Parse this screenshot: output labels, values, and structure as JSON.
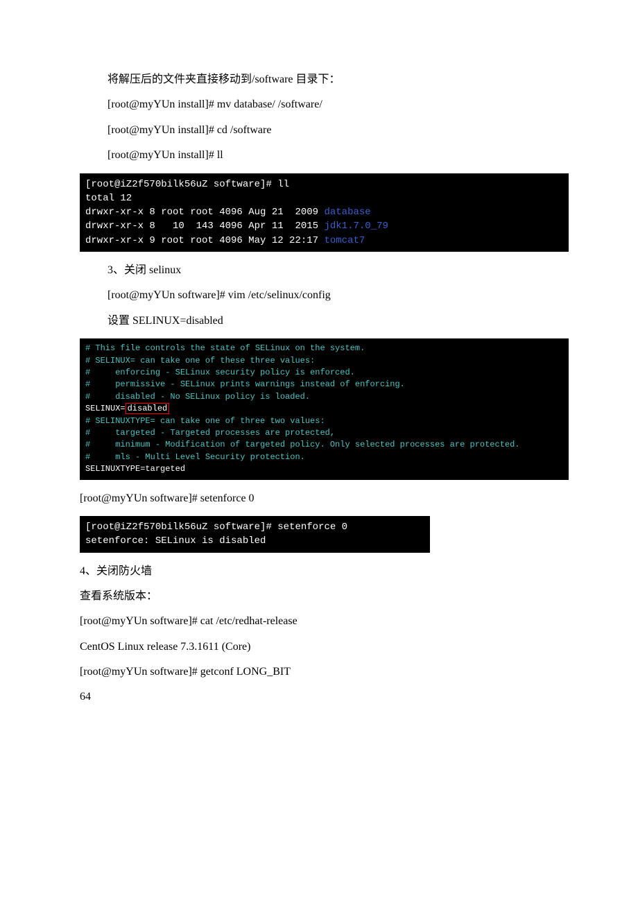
{
  "paragraphs": {
    "p1": "将解压后的文件夹直接移动到/software 目录下：",
    "p2": "[root@myYUn install]# mv database/ /software/",
    "p3": "[root@myYUn install]# cd /software",
    "p4": "[root@myYUn install]# ll",
    "p5": "3、关闭 selinux",
    "p6": "[root@myYUn software]# vim /etc/selinux/config",
    "p7": "设置 SELINUX=disabled",
    "p8": "[root@myYUn software]# setenforce 0",
    "p9": "4、关闭防火墙",
    "p10": "查看系统版本：",
    "p11": "[root@myYUn software]# cat /etc/redhat-release",
    "p12": "CentOS Linux release 7.3.1611 (Core)",
    "p13": "[root@myYUn software]# getconf LONG_BIT",
    "p14": "64"
  },
  "terminal1": {
    "line1": "[root@iZ2f570bilk56uZ software]# ll",
    "line2": "total 12",
    "line3a": "drwxr-xr-x 8 root root 4096 Aug 21  2009 ",
    "line3b": "database",
    "line4a": "drwxr-xr-x 8   10  143 4096 Apr 11  2015 ",
    "line4b": "jdk1.7.0_79",
    "line5a": "drwxr-xr-x 9 root root 4096 May 12 22:17 ",
    "line5b": "tomcat7"
  },
  "terminal2": {
    "l1": "# This file controls the state of SELinux on the system.",
    "l2": "# SELINUX= can take one of these three values:",
    "l3": "#     enforcing - SELinux security policy is enforced.",
    "l4": "#     permissive - SELinux prints warnings instead of enforcing.",
    "l5": "#     disabled - No SELinux policy is loaded.",
    "l6a": "SELINUX=",
    "l6b": "disabled",
    "l7": "# SELINUXTYPE= can take one of three two values:",
    "l8": "#     targeted - Targeted processes are protected,",
    "l9": "#     minimum - Modification of targeted policy. Only selected processes are protected.",
    "l10": "#     mls - Multi Level Security protection.",
    "l11": "SELINUXTYPE=targeted"
  },
  "terminal3": {
    "l1": "[root@iZ2f570bilk56uZ software]# setenforce 0",
    "l2": "setenforce: SELinux is disabled"
  }
}
